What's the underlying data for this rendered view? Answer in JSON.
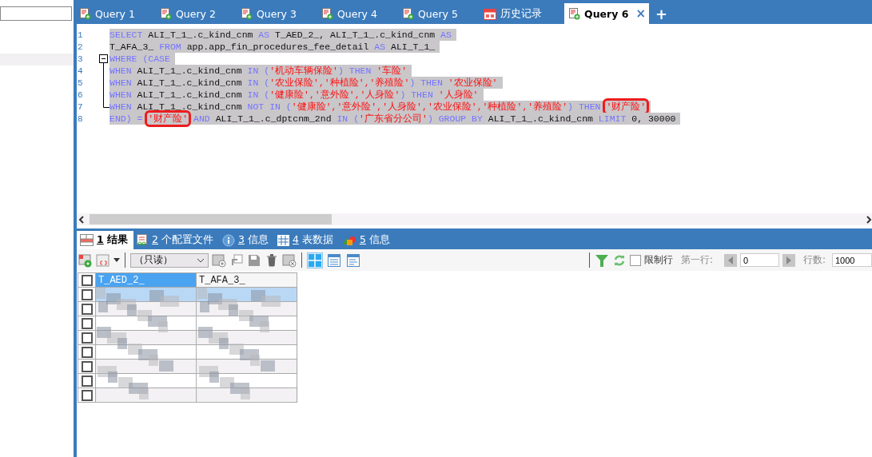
{
  "tabs": [
    {
      "label": "Query 1",
      "kind": "query",
      "selected": false
    },
    {
      "label": "Query 2",
      "kind": "query",
      "selected": false
    },
    {
      "label": "Query 3",
      "kind": "query",
      "selected": false
    },
    {
      "label": "Query 4",
      "kind": "query",
      "selected": false
    },
    {
      "label": "Query 5",
      "kind": "query",
      "selected": false
    },
    {
      "label": "历史记录",
      "kind": "history",
      "selected": false
    },
    {
      "label": "Query 6",
      "kind": "query",
      "selected": true,
      "close": "×"
    }
  ],
  "new_tab": "+",
  "editor": {
    "lines": [
      {
        "number": "1",
        "kind": "plain",
        "segments": [
          {
            "t": "SELECT",
            "kind": "kw"
          },
          {
            "t": " ALI_T_1_.c_kind_cnm ",
            "kind": "id"
          },
          {
            "t": "AS",
            "kind": "kw"
          },
          {
            "t": " T_AED_2_, ALI_T_1_.c_kind_cnm ",
            "kind": "id"
          },
          {
            "t": "AS",
            "kind": "kw"
          }
        ]
      },
      {
        "number": "2",
        "kind": "plain",
        "segments": [
          {
            "t": "T_AFA_3_ ",
            "kind": "id"
          },
          {
            "t": "FROM",
            "kind": "kw"
          },
          {
            "t": " app.app_fin_procedures_fee_detail ",
            "kind": "id"
          },
          {
            "t": "AS",
            "kind": "kw"
          },
          {
            "t": " ALI_T_1_",
            "kind": "id"
          }
        ]
      },
      {
        "number": "3",
        "kind": "open",
        "segments": [
          {
            "t": "WHERE (CASE",
            "kind": "kw"
          }
        ]
      },
      {
        "number": "4",
        "kind": "inside",
        "segments": [
          {
            "t": "WHEN",
            "kind": "kw"
          },
          {
            "t": " ALI_T_1_.c_kind_cnm ",
            "kind": "id"
          },
          {
            "t": "IN (",
            "kind": "kw"
          },
          {
            "t": "'机动车辆保险'",
            "kind": "str"
          },
          {
            "t": ") THEN ",
            "kind": "kw"
          },
          {
            "t": "'车险'",
            "kind": "str"
          }
        ]
      },
      {
        "number": "5",
        "kind": "inside",
        "segments": [
          {
            "t": "WHEN",
            "kind": "kw"
          },
          {
            "t": " ALI_T_1_.c_kind_cnm ",
            "kind": "id"
          },
          {
            "t": "IN (",
            "kind": "kw"
          },
          {
            "t": "'农业保险','种植险','养殖险'",
            "kind": "str"
          },
          {
            "t": ") THEN ",
            "kind": "kw"
          },
          {
            "t": "'农业保险'",
            "kind": "str"
          }
        ]
      },
      {
        "number": "6",
        "kind": "inside",
        "segments": [
          {
            "t": "WHEN",
            "kind": "kw"
          },
          {
            "t": " ALI_T_1_.c_kind_cnm ",
            "kind": "id"
          },
          {
            "t": "IN (",
            "kind": "kw"
          },
          {
            "t": "'健康险','意外险','人身险'",
            "kind": "str"
          },
          {
            "t": ") THEN ",
            "kind": "kw"
          },
          {
            "t": "'人身险'",
            "kind": "str"
          }
        ]
      },
      {
        "number": "7",
        "kind": "end",
        "segments": [
          {
            "t": "WHEN",
            "kind": "kw"
          },
          {
            "t": " ALI_T_1_.c_kind_cnm ",
            "kind": "id"
          },
          {
            "t": "NOT IN (",
            "kind": "kw"
          },
          {
            "t": "'健康险','意外险','人身险','农业保险','种植险','养殖险'",
            "kind": "str"
          },
          {
            "t": ") THEN ",
            "kind": "kw"
          },
          {
            "t": "'财产险'",
            "kind": "str",
            "boxed": true
          }
        ]
      },
      {
        "number": "8",
        "kind": "plain",
        "segments": [
          {
            "t": "END) = ",
            "kind": "kw"
          },
          {
            "t": "'财产险'",
            "kind": "str",
            "boxed": true
          },
          {
            "t": " AND",
            "kind": "kw"
          },
          {
            "t": " ALI_T_1_.c_dptcnm_2nd ",
            "kind": "id"
          },
          {
            "t": "IN (",
            "kind": "kw"
          },
          {
            "t": "'广东省分公司'",
            "kind": "str"
          },
          {
            "t": ") GROUP BY",
            "kind": "kw"
          },
          {
            "t": " ALI_T_1_.c_kind_cnm ",
            "kind": "id"
          },
          {
            "t": "LIMIT",
            "kind": "kw"
          },
          {
            "t": " 0, 30000",
            "kind": "id"
          }
        ]
      }
    ]
  },
  "result_tabs": [
    {
      "key": "1",
      "label": "结果",
      "kind": "result",
      "selected": true
    },
    {
      "key": "2",
      "label": "个配置文件",
      "kind": "profile",
      "selected": false
    },
    {
      "key": "3",
      "label": "信息",
      "kind": "info",
      "selected": false
    },
    {
      "key": "4",
      "label": "表数据",
      "kind": "table",
      "selected": false
    },
    {
      "key": "5",
      "label": "信息",
      "kind": "shapes",
      "selected": false
    }
  ],
  "toolbar": {
    "mode_select": "（只读）",
    "views": [
      {
        "kind": "grid",
        "selected": true
      },
      {
        "kind": "form",
        "selected": false
      },
      {
        "kind": "text",
        "selected": false
      }
    ],
    "limit_rows": {
      "label": "限制行",
      "checked": false
    },
    "first_row_label": "第一行:",
    "first_row_value": "0",
    "row_count_label": "行数:",
    "row_count_value": "1000"
  },
  "grid": {
    "all_checked": false,
    "columns": [
      {
        "label": "T_AED_2_",
        "selected": true
      },
      {
        "label": "T_AFA_3_",
        "selected": false
      }
    ],
    "rows": [
      {
        "selected": true,
        "checked": false
      },
      {
        "selected": false,
        "checked": false
      },
      {
        "selected": false,
        "checked": false
      },
      {
        "selected": false,
        "checked": false
      },
      {
        "selected": false,
        "checked": false
      },
      {
        "selected": false,
        "checked": false
      },
      {
        "selected": false,
        "checked": false
      },
      {
        "selected": false,
        "checked": false
      }
    ]
  }
}
